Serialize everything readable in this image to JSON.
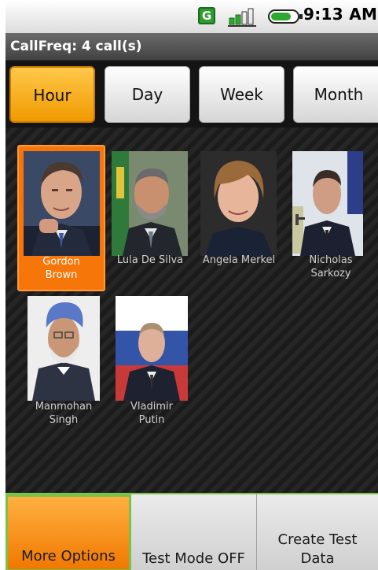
{
  "status_bar": {
    "indicator_letter": "G",
    "time": "9:13 AM",
    "icons": [
      "g-notification-icon",
      "signal-icon",
      "battery-icon"
    ]
  },
  "title": "CallFreq: 4 call(s)",
  "tabs": [
    {
      "label": "Hour",
      "selected": true
    },
    {
      "label": "Day",
      "selected": false
    },
    {
      "label": "Week",
      "selected": false
    },
    {
      "label": "Month",
      "selected": false
    }
  ],
  "contacts": [
    {
      "line1": "Gordon",
      "line2": "Brown",
      "selected": true
    },
    {
      "line1": "Lula De Silva",
      "line2": "",
      "selected": false
    },
    {
      "line1": "Angela Merkel",
      "line2": "",
      "selected": false
    },
    {
      "line1": "Nicholas",
      "line2": "Sarkozy",
      "selected": false
    },
    {
      "line1": "Manmohan",
      "line2": "Singh",
      "selected": false
    },
    {
      "line1": "Vladimir",
      "line2": "Putin",
      "selected": false
    }
  ],
  "menu": [
    {
      "line1": "More Options",
      "line2": "",
      "active": true
    },
    {
      "line1": "Test Mode OFF",
      "line2": "",
      "active": false
    },
    {
      "line1": "Create Test",
      "line2": "Data",
      "active": false
    }
  ],
  "colors": {
    "accent_orange": "#f7760a",
    "menu_border_green": "#7fc34a",
    "background": "#141414"
  }
}
